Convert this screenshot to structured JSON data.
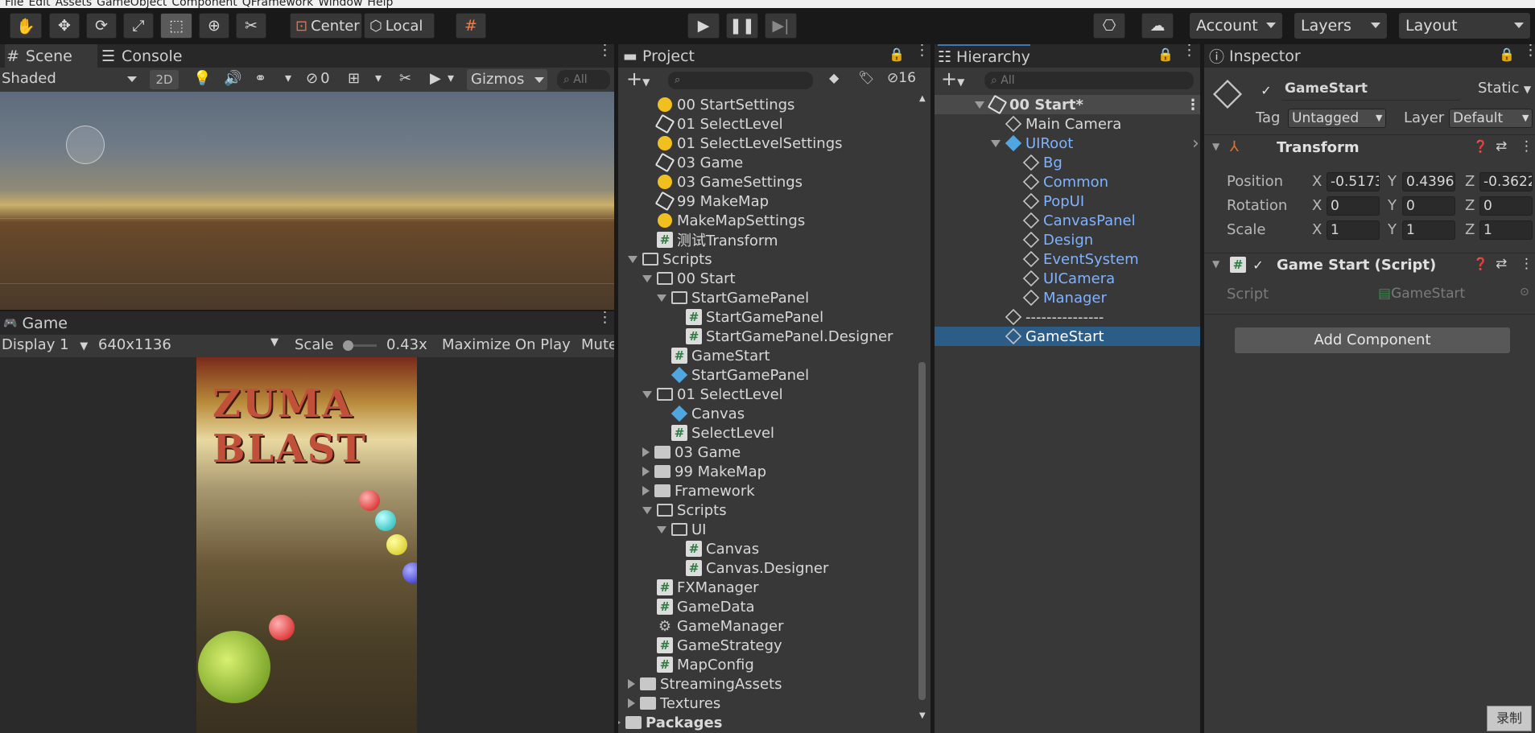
{
  "menubar": {
    "items": [
      "File",
      "Edit",
      "Assets",
      "GameObject",
      "Component",
      "QFramework",
      "Window",
      "Help"
    ]
  },
  "toolbar": {
    "tools": [
      "hand-icon",
      "move-icon",
      "rotate-icon",
      "scale-icon",
      "rect-icon",
      "transform-icon",
      "custom-tool-icon"
    ],
    "pivot_label": "Center",
    "space_label": "Local",
    "account_label": "Account",
    "layers_label": "Layers",
    "layout_label": "Layout"
  },
  "scene": {
    "tab_scene": "Scene",
    "tab_console": "Console",
    "shading": "Shaded",
    "mode_2d": "2D",
    "hidden_count": "0",
    "gizmos": "Gizmos",
    "search_placeholder": "All"
  },
  "game": {
    "tab": "Game",
    "display": "Display 1",
    "resolution": "640x1136",
    "scale_label": "Scale",
    "scale_value": "0.43x",
    "maximize": "Maximize On Play",
    "mute": "Mute",
    "logo_text": "ZUMA BLAST"
  },
  "project": {
    "tab": "Project",
    "hidden_count": "16",
    "items": [
      {
        "indent": 0,
        "icon": "bulb",
        "label": "00 StartSettings"
      },
      {
        "indent": 0,
        "icon": "unity",
        "label": "01 SelectLevel"
      },
      {
        "indent": 0,
        "icon": "bulb",
        "label": "01 SelectLevelSettings"
      },
      {
        "indent": 0,
        "icon": "unity",
        "label": "03 Game"
      },
      {
        "indent": 0,
        "icon": "bulb",
        "label": "03 GameSettings"
      },
      {
        "indent": 0,
        "icon": "unity",
        "label": "99 MakeMap"
      },
      {
        "indent": 0,
        "icon": "bulb",
        "label": "MakeMapSettings"
      },
      {
        "indent": 0,
        "icon": "hash",
        "label": "测试Transform"
      },
      {
        "indent": -1,
        "icon": "folder-open",
        "arrow": "down",
        "label": "Scripts"
      },
      {
        "indent": 0,
        "icon": "folder-open",
        "arrow": "down",
        "label": "00 Start"
      },
      {
        "indent": 1,
        "icon": "folder-open",
        "arrow": "down",
        "label": "StartGamePanel"
      },
      {
        "indent": 2,
        "icon": "hash",
        "label": "StartGamePanel"
      },
      {
        "indent": 2,
        "icon": "hash",
        "label": "StartGamePanel.Designer"
      },
      {
        "indent": 1,
        "icon": "hash",
        "label": "GameStart"
      },
      {
        "indent": 1,
        "icon": "cube-blue",
        "label": "StartGamePanel"
      },
      {
        "indent": 0,
        "icon": "folder-open",
        "arrow": "down",
        "label": "01 SelectLevel"
      },
      {
        "indent": 1,
        "icon": "cube-blue",
        "label": "Canvas"
      },
      {
        "indent": 1,
        "icon": "hash",
        "label": "SelectLevel"
      },
      {
        "indent": 0,
        "icon": "folder",
        "arrow": "right",
        "label": "03 Game"
      },
      {
        "indent": 0,
        "icon": "folder",
        "arrow": "right",
        "label": "99 MakeMap"
      },
      {
        "indent": 0,
        "icon": "folder",
        "arrow": "right",
        "label": "Framework"
      },
      {
        "indent": 0,
        "icon": "folder-open",
        "arrow": "down",
        "label": "Scripts"
      },
      {
        "indent": 1,
        "icon": "folder-open",
        "arrow": "down",
        "label": "UI"
      },
      {
        "indent": 2,
        "icon": "hash",
        "label": "Canvas"
      },
      {
        "indent": 2,
        "icon": "hash",
        "label": "Canvas.Designer"
      },
      {
        "indent": 0,
        "icon": "hash",
        "label": "FXManager"
      },
      {
        "indent": 0,
        "icon": "hash",
        "label": "GameData"
      },
      {
        "indent": 0,
        "icon": "gear",
        "label": "GameManager"
      },
      {
        "indent": 0,
        "icon": "hash",
        "label": "GameStrategy"
      },
      {
        "indent": 0,
        "icon": "hash",
        "label": "MapConfig"
      },
      {
        "indent": -1,
        "icon": "folder",
        "arrow": "right",
        "label": "StreamingAssets"
      },
      {
        "indent": -1,
        "icon": "folder",
        "arrow": "right",
        "label": "Textures"
      },
      {
        "indent": -2,
        "icon": "folder",
        "arrow": "right",
        "label": "Packages",
        "bold": true
      }
    ]
  },
  "hierarchy": {
    "tab": "Hierarchy",
    "search_placeholder": "All",
    "items": [
      {
        "indent": 0,
        "icon": "unity",
        "arrow": "down",
        "label": "00 Start*",
        "scene": true
      },
      {
        "indent": 1,
        "icon": "cube",
        "label": "Main Camera"
      },
      {
        "indent": 1,
        "icon": "cube-blue",
        "arrow": "down",
        "label": "UIRoot",
        "blue": true,
        "chevron": true
      },
      {
        "indent": 2,
        "icon": "cube",
        "label": "Bg",
        "blue": true
      },
      {
        "indent": 2,
        "icon": "cube",
        "label": "Common",
        "blue": true
      },
      {
        "indent": 2,
        "icon": "cube",
        "label": "PopUI",
        "blue": true
      },
      {
        "indent": 2,
        "icon": "cube",
        "label": "CanvasPanel",
        "blue": true
      },
      {
        "indent": 2,
        "icon": "cube",
        "label": "Design",
        "blue": true
      },
      {
        "indent": 2,
        "icon": "cube",
        "label": "EventSystem",
        "blue": true
      },
      {
        "indent": 2,
        "icon": "cube",
        "label": "UICamera",
        "blue": true
      },
      {
        "indent": 2,
        "icon": "cube",
        "label": "Manager",
        "blue": true
      },
      {
        "indent": 1,
        "icon": "cube",
        "label": "---------------"
      },
      {
        "indent": 1,
        "icon": "cube",
        "label": "GameStart",
        "selected": true
      }
    ]
  },
  "inspector": {
    "tab": "Inspector",
    "object_name": "GameStart",
    "static_label": "Static",
    "tag_label": "Tag",
    "tag_value": "Untagged",
    "layer_label": "Layer",
    "layer_value": "Default",
    "transform_title": "Transform",
    "position_label": "Position",
    "rotation_label": "Rotation",
    "scale_label": "Scale",
    "position": {
      "x": "-0.5173",
      "y": "0.4396",
      "z": "-0.3622"
    },
    "rotation": {
      "x": "0",
      "y": "0",
      "z": "0"
    },
    "scale": {
      "x": "1",
      "y": "1",
      "z": "1"
    },
    "axis_x": "X",
    "axis_y": "Y",
    "axis_z": "Z",
    "script_component_title": "Game Start (Script)",
    "script_label": "Script",
    "script_value": "GameStart",
    "add_component": "Add Component",
    "record_label": "录制"
  }
}
